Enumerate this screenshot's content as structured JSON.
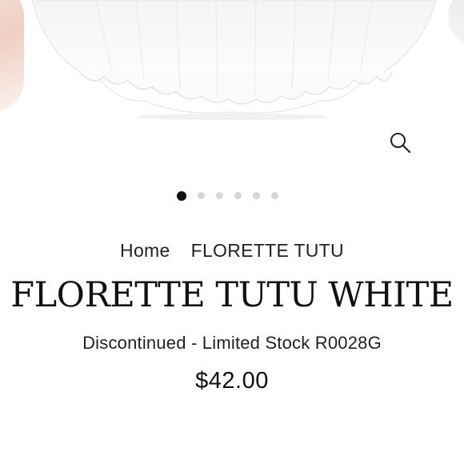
{
  "carousel": {
    "slide_count": 6,
    "active_index": 0,
    "zoom_icon": "magnifier-icon"
  },
  "breadcrumb": {
    "home": "Home",
    "current": "FLORETTE TUTU"
  },
  "product": {
    "title": "FLORETTE TUTU WHITE",
    "subtitle": "Discontinued - Limited Stock R0028G",
    "price": "$42.00"
  },
  "colors": {
    "dot_active": "#111111",
    "dot_inactive": "#d6d6d6",
    "text": "#111111"
  }
}
